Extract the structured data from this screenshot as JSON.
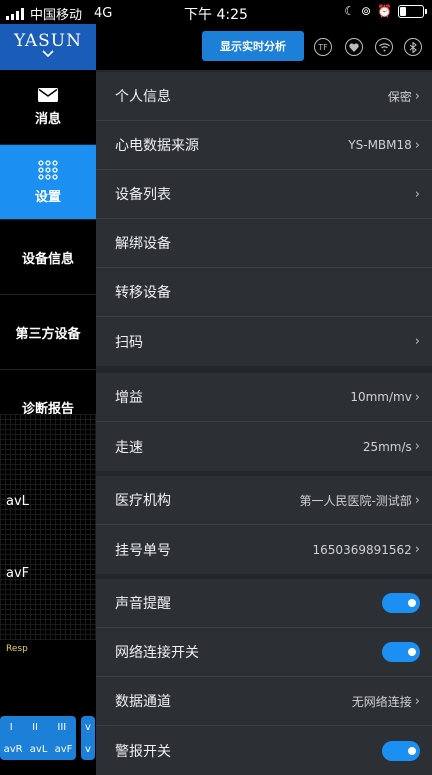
{
  "status_bar": {
    "carrier": "中国移动",
    "network": "4G",
    "time": "下午 4:25",
    "battery_level": 0.3
  },
  "sidebar": {
    "logo": "YASUN",
    "nav": [
      {
        "label": "消息",
        "icon": "envelope-icon",
        "active": false
      },
      {
        "label": "设置",
        "icon": "grid-dots-icon",
        "active": true
      },
      {
        "label": "设备信息",
        "active": false
      },
      {
        "label": "第三方设备",
        "active": false
      },
      {
        "label": "诊断报告",
        "active": false
      }
    ],
    "leads": [
      "avL",
      "avF"
    ],
    "resp_label": "Resp",
    "chip1": {
      "top": [
        "I",
        "II",
        "III"
      ],
      "bottom": [
        "avR",
        "avL",
        "avF"
      ]
    },
    "chip2": {
      "top": "v",
      "bottom": "v"
    }
  },
  "topbar": {
    "realtime_button": "显示实时分析",
    "icons": [
      "tf-card-icon",
      "heart-icon",
      "wifi-icon",
      "bluetooth-icon"
    ],
    "tf_label": "TF"
  },
  "settings": {
    "group1": [
      {
        "label": "个人信息",
        "value": "保密",
        "chevron": true
      },
      {
        "label": "心电数据来源",
        "value": "YS-MBM18",
        "chevron": true
      },
      {
        "label": "设备列表",
        "value": "",
        "chevron": true
      },
      {
        "label": "解绑设备",
        "value": "",
        "chevron": false
      },
      {
        "label": "转移设备",
        "value": "",
        "chevron": false
      },
      {
        "label": "扫码",
        "value": "",
        "chevron": true
      }
    ],
    "group2": [
      {
        "label": "增益",
        "value": "10mm/mv",
        "chevron": true
      },
      {
        "label": "走速",
        "value": "25mm/s",
        "chevron": true
      }
    ],
    "group3": [
      {
        "label": "医疗机构",
        "value": "第一人民医院-测试部",
        "chevron": true
      },
      {
        "label": "挂号单号",
        "value": "1650369891562",
        "chevron": true
      }
    ],
    "group4": [
      {
        "label": "声音提醒",
        "toggle": true
      },
      {
        "label": "网络连接开关",
        "toggle": true
      },
      {
        "label": "数据通道",
        "value": "无网络连接",
        "chevron": true
      },
      {
        "label": "警报开关",
        "toggle": true
      }
    ]
  },
  "colors": {
    "accent": "#1c90f2",
    "panel": "#2c3035",
    "logo_bg": "#1a5db8"
  }
}
